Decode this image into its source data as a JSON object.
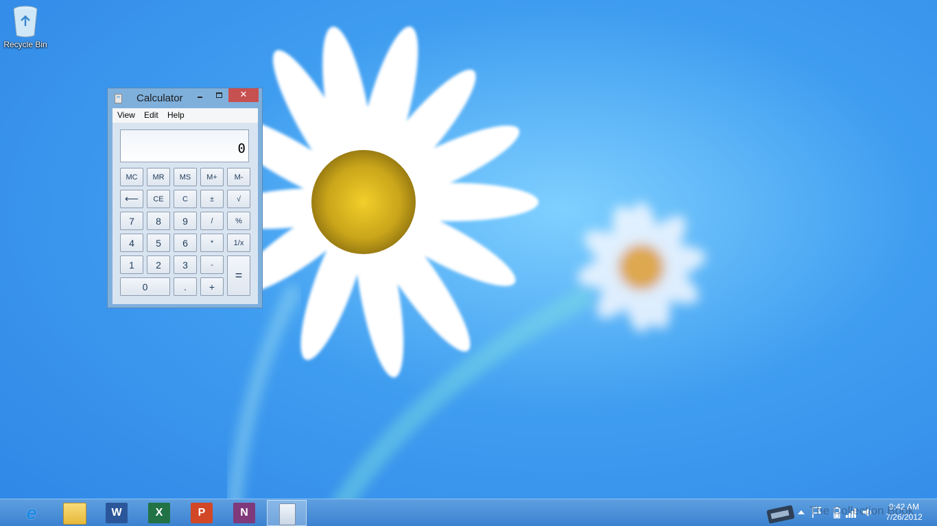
{
  "desktop": {
    "recycle_bin_label": "Recycle Bin"
  },
  "calculator": {
    "title": "Calculator",
    "close_glyph": "✕",
    "menu": [
      "View",
      "Edit",
      "Help"
    ],
    "display_value": "0",
    "keys": {
      "mc": "MC",
      "mr": "MR",
      "ms": "MS",
      "mplus": "M+",
      "mminus": "M-",
      "backspace": "⟵",
      "ce": "CE",
      "c": "C",
      "plusminus": "±",
      "sqrt": "√",
      "k7": "7",
      "k8": "8",
      "k9": "9",
      "div": "/",
      "pct": "%",
      "k4": "4",
      "k5": "5",
      "k6": "6",
      "mul": "*",
      "recip": "1/x",
      "k1": "1",
      "k2": "2",
      "k3": "3",
      "sub": "-",
      "eq": "=",
      "k0": "0",
      "dot": ".",
      "add": "+"
    }
  },
  "taskbar": {
    "apps": [
      {
        "name": "Internet Explorer",
        "icon": "ie-icon",
        "glyph": "e",
        "color": "#1e88e5"
      },
      {
        "name": "File Explorer",
        "icon": "folder-icon",
        "glyph": "",
        "color": "#f2c94c"
      },
      {
        "name": "Word",
        "icon": "word-icon",
        "glyph": "W",
        "color": "#2b579a"
      },
      {
        "name": "Excel",
        "icon": "excel-icon",
        "glyph": "X",
        "color": "#217346"
      },
      {
        "name": "PowerPoint",
        "icon": "powerpoint-icon",
        "glyph": "P",
        "color": "#d24726"
      },
      {
        "name": "OneNote",
        "icon": "onenote-icon",
        "glyph": "N",
        "color": "#80397b"
      },
      {
        "name": "Calculator",
        "icon": "calculator-icon",
        "glyph": "",
        "color": "#dfe8f3",
        "active": true
      }
    ],
    "clock": {
      "time": "9:42 AM",
      "date": "7/26/2012"
    },
    "watermark": "The Collection Book"
  }
}
